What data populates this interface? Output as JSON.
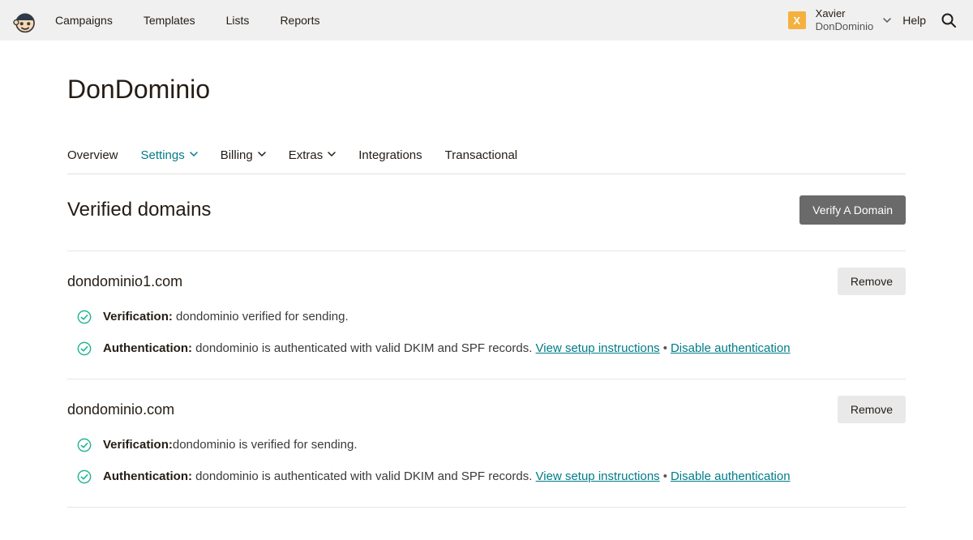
{
  "topnav": {
    "items": [
      "Campaigns",
      "Templates",
      "Lists",
      "Reports"
    ]
  },
  "user": {
    "initial": "X",
    "name": "Xavier",
    "org": "DonDominio"
  },
  "help": "Help",
  "page_title": "DonDominio",
  "tabs": [
    {
      "label": "Overview",
      "dropdown": false,
      "active": false
    },
    {
      "label": "Settings",
      "dropdown": true,
      "active": true
    },
    {
      "label": "Billing",
      "dropdown": true,
      "active": false
    },
    {
      "label": "Extras",
      "dropdown": true,
      "active": false
    },
    {
      "label": "Integrations",
      "dropdown": false,
      "active": false
    },
    {
      "label": "Transactional",
      "dropdown": false,
      "active": false
    }
  ],
  "section": {
    "title": "Verified domains",
    "verify_button": "Verify A Domain"
  },
  "domains": [
    {
      "name": "dondominio1.com",
      "remove": "Remove",
      "verification_label": "Verification:",
      "verification_text": " dondominio verified for sending.",
      "auth_label": "Authentication:",
      "auth_text": " dondominio is authenticated with valid DKIM and SPF records. ",
      "link_setup": "View setup instructions",
      "sep": "•",
      "link_disable": "Disable authentication"
    },
    {
      "name": "dondominio.com",
      "remove": "Remove",
      "verification_label": "Verification:",
      "verification_text": "dondominio is verified for sending.",
      "auth_label": "Authentication:",
      "auth_text": " dondominio is authenticated with valid DKIM and SPF records. ",
      "link_setup": "View setup instructions",
      "sep": "•",
      "link_disable": "Disable authentication"
    }
  ]
}
